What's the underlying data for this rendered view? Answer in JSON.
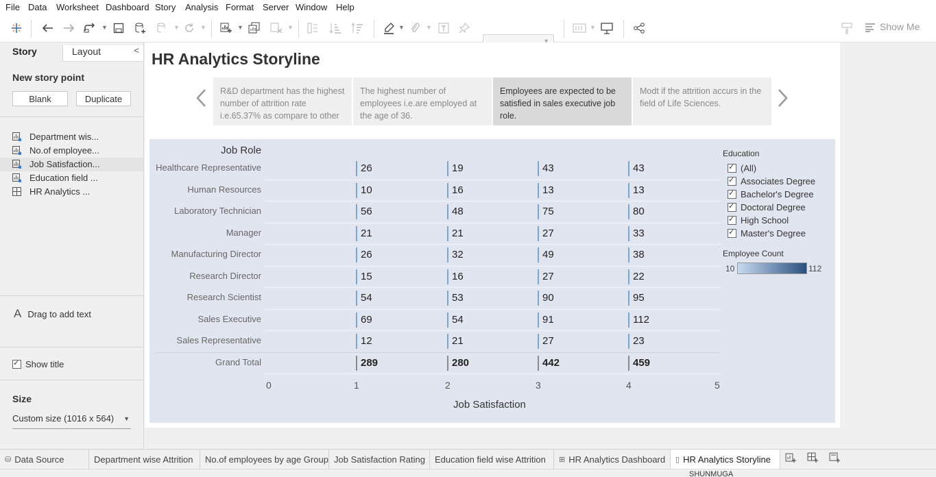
{
  "menu": [
    "File",
    "Data",
    "Worksheet",
    "Dashboard",
    "Story",
    "Analysis",
    "Format",
    "Server",
    "Window",
    "Help"
  ],
  "toolbar": {
    "show_me": "Show Me"
  },
  "sidebar": {
    "tab_story": "Story",
    "tab_layout": "Layout",
    "collapse": "<",
    "new_story_point": "New story point",
    "blank_btn": "Blank",
    "duplicate_btn": "Duplicate",
    "sheets": [
      {
        "label": "Department wis...",
        "icon": "worksheet-icon"
      },
      {
        "label": "No.of employee...",
        "icon": "worksheet-icon"
      },
      {
        "label": "Job Satisfaction...",
        "icon": "worksheet-icon"
      },
      {
        "label": "Education field ...",
        "icon": "worksheet-icon"
      },
      {
        "label": "HR Analytics ...",
        "icon": "dashboard-icon"
      }
    ],
    "drag_text": "Drag to add text",
    "show_title": "Show title",
    "size_heading": "Size",
    "size_value": "Custom size (1016 x 564)"
  },
  "story": {
    "title": "HR Analytics Storyline",
    "points": [
      {
        "text": "R&D department has the highest number of attrition rate i.e.65.37% as compare to other",
        "active": false
      },
      {
        "text": "The highest number of employees i.e.are employed at the age of 36.",
        "active": false
      },
      {
        "text": "Employees are expected to be satisfied in sales executive job role.",
        "active": true
      },
      {
        "text": "Modt if the attrition accurs in the field of Life Sciences.",
        "active": false
      }
    ]
  },
  "viz": {
    "row_header": "Job Role",
    "x_axis_title": "Job Satisfaction",
    "x_ticks": [
      "0",
      "1",
      "2",
      "3",
      "4",
      "5"
    ],
    "rows": [
      {
        "role": "Healthcare Representative",
        "values": [
          "26",
          "19",
          "43",
          "43"
        ]
      },
      {
        "role": "Human Resources",
        "values": [
          "10",
          "16",
          "13",
          "13"
        ]
      },
      {
        "role": "Laboratory Technician",
        "values": [
          "56",
          "48",
          "75",
          "80"
        ]
      },
      {
        "role": "Manager",
        "values": [
          "21",
          "21",
          "27",
          "33"
        ]
      },
      {
        "role": "Manufacturing Director",
        "values": [
          "26",
          "32",
          "49",
          "38"
        ]
      },
      {
        "role": "Research Director",
        "values": [
          "15",
          "16",
          "27",
          "22"
        ]
      },
      {
        "role": "Research Scientist",
        "values": [
          "54",
          "53",
          "90",
          "95"
        ]
      },
      {
        "role": "Sales Executive",
        "values": [
          "69",
          "54",
          "91",
          "112"
        ]
      },
      {
        "role": "Sales Representative",
        "values": [
          "12",
          "21",
          "27",
          "23"
        ]
      }
    ],
    "grand_total": {
      "label": "Grand Total",
      "values": [
        "289",
        "280",
        "442",
        "459"
      ]
    }
  },
  "legend": {
    "education_title": "Education",
    "education_items": [
      "(All)",
      "Associates Degree",
      "Bachelor's Degree",
      "Doctoral Degree",
      "High School",
      "Master's Degree"
    ],
    "count_title": "Employee Count",
    "count_min": "10",
    "count_max": "112",
    "ramp_low_color": "#c6dbef",
    "ramp_high_color": "#2b4f7e"
  },
  "tabs": [
    {
      "label": "Data Source",
      "icon": "database-icon",
      "active": false
    },
    {
      "label": "Department wise Attrition",
      "active": false
    },
    {
      "label": "No.of employees by age Group",
      "active": false
    },
    {
      "label": "Job Satisfaction Rating",
      "active": false
    },
    {
      "label": "Education field wise Attrition",
      "active": false
    },
    {
      "label": "HR Analytics Dashboard",
      "icon": "dashboard-icon",
      "active": false
    },
    {
      "label": "HR Analytics Storyline",
      "icon": "story-icon",
      "active": true
    }
  ],
  "status": {
    "user": "SHUNMUGA"
  }
}
